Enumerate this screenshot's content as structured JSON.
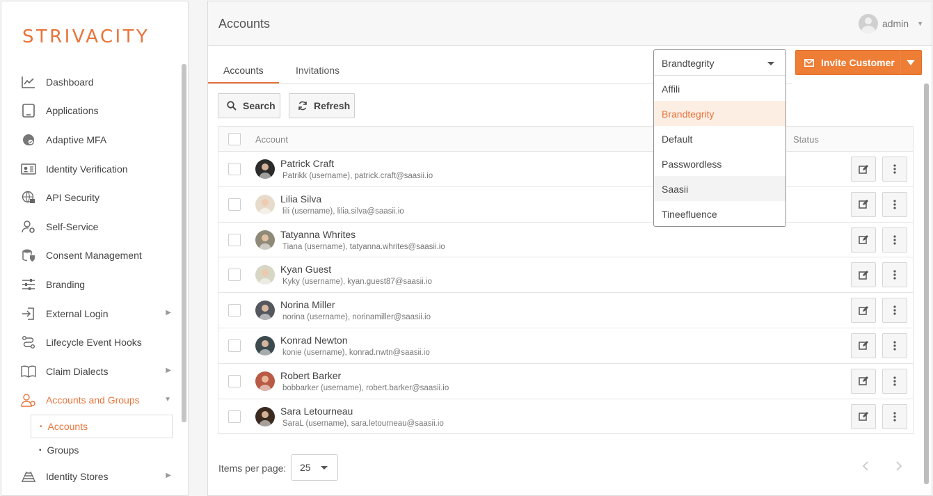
{
  "brand": {
    "logo_text": "STRIVACITY",
    "accent_color": "#e8743b"
  },
  "sidebar": {
    "items": [
      {
        "label": "Dashboard",
        "icon": "chart-line-icon",
        "has_children": false
      },
      {
        "label": "Applications",
        "icon": "tablet-icon",
        "has_children": false
      },
      {
        "label": "Adaptive MFA",
        "icon": "fingerprint-icon",
        "has_children": false
      },
      {
        "label": "Identity Verification",
        "icon": "id-card-icon",
        "has_children": false
      },
      {
        "label": "API Security",
        "icon": "globe-lock-icon",
        "has_children": false
      },
      {
        "label": "Self-Service",
        "icon": "user-gear-icon",
        "has_children": false
      },
      {
        "label": "Consent Management",
        "icon": "database-check-icon",
        "has_children": false
      },
      {
        "label": "Branding",
        "icon": "sliders-icon",
        "has_children": false
      },
      {
        "label": "External Login",
        "icon": "login-arrow-icon",
        "has_children": true
      },
      {
        "label": "Lifecycle Event Hooks",
        "icon": "route-icon",
        "has_children": false
      },
      {
        "label": "Claim Dialects",
        "icon": "book-icon",
        "has_children": true
      },
      {
        "label": "Accounts and Groups",
        "icon": "users-icon",
        "has_children": true,
        "active": true
      },
      {
        "label": "Identity Stores",
        "icon": "stack-icon",
        "has_children": true
      }
    ],
    "sub_items": [
      {
        "label": "Accounts",
        "active": true
      },
      {
        "label": "Groups",
        "active": false
      }
    ]
  },
  "header": {
    "title": "Accounts",
    "user_name": "admin"
  },
  "tabs": [
    {
      "label": "Accounts",
      "active": true
    },
    {
      "label": "Invitations",
      "active": false
    }
  ],
  "toolbar": {
    "search_label": "Search",
    "refresh_label": "Refresh",
    "invite_label": "Invite Customer"
  },
  "brand_select": {
    "selected": "Brandtegrity",
    "options": [
      "Affili",
      "Brandtegrity",
      "Default",
      "Passwordless",
      "Saasii",
      "Tineefluence"
    ],
    "active_option": "Brandtegrity",
    "hover_option": "Saasii"
  },
  "table": {
    "columns": {
      "account": "Account",
      "status": "Status"
    },
    "rows": [
      {
        "name": "Patrick Craft",
        "detail": "Patrikk (username), patrick.craft@saasii.io",
        "avatar_color": "#2b2b2b"
      },
      {
        "name": "Lilia Silva",
        "detail": "lili (username), lilia.silva@saasii.io",
        "avatar_color": "#e7dccb"
      },
      {
        "name": "Tatyanna Whrites",
        "detail": "Tiana (username), tatyanna.whrites@saasii.io",
        "avatar_color": "#8f8a78"
      },
      {
        "name": "Kyan Guest",
        "detail": "Kyky (username), kyan.guest87@saasii.io",
        "avatar_color": "#d8d6c4"
      },
      {
        "name": "Norina Miller",
        "detail": "norina (username), norinamiller@saasii.io",
        "avatar_color": "#55575e"
      },
      {
        "name": "Konrad Newton",
        "detail": "konie (username), konrad.nwtn@saasii.io",
        "avatar_color": "#3c4a4e"
      },
      {
        "name": "Robert Barker",
        "detail": "bobbarker (username), robert.barker@saasii.io",
        "avatar_color": "#b85a45"
      },
      {
        "name": "Sara Letourneau",
        "detail": "SaraL (username), sara.letourneau@saasii.io",
        "avatar_color": "#3a2a20"
      }
    ]
  },
  "pagination": {
    "items_per_page_label": "Items per page:",
    "items_per_page_value": "25"
  }
}
